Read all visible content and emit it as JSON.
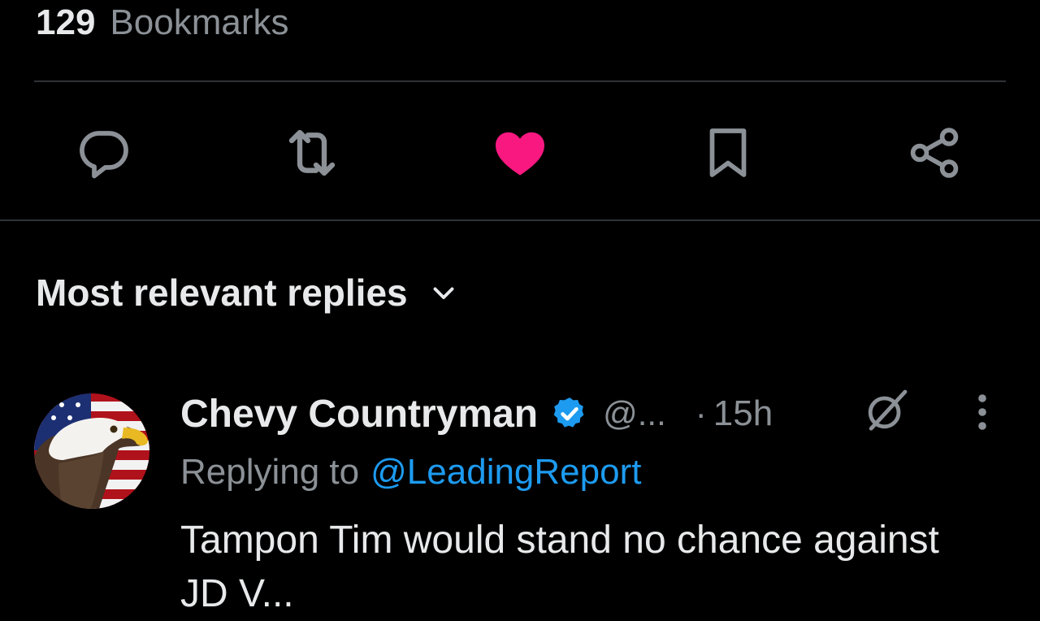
{
  "stats": {
    "bookmarks_count": "129",
    "bookmarks_label": "Bookmarks"
  },
  "actions": {
    "reply_icon": "reply-icon",
    "repost_icon": "repost-icon",
    "like_icon": "heart-icon",
    "like_color": "#f91880",
    "bookmark_icon": "bookmark-icon",
    "share_icon": "share-icon"
  },
  "sort": {
    "label": "Most relevant replies"
  },
  "reply": {
    "display_name": "Chevy Countryman",
    "handle": "@...",
    "separator": "·",
    "time": "15h",
    "replying_prefix": "Replying to",
    "replying_to": "@LeadingReport",
    "text": "Tampon Tim would stand no chance against JD V..."
  },
  "colors": {
    "background": "#000000",
    "text_primary": "#e7e9ea",
    "text_secondary": "#8b9196",
    "link": "#1d9bf0",
    "verified": "#1d9bf0",
    "divider": "#2f3336"
  }
}
